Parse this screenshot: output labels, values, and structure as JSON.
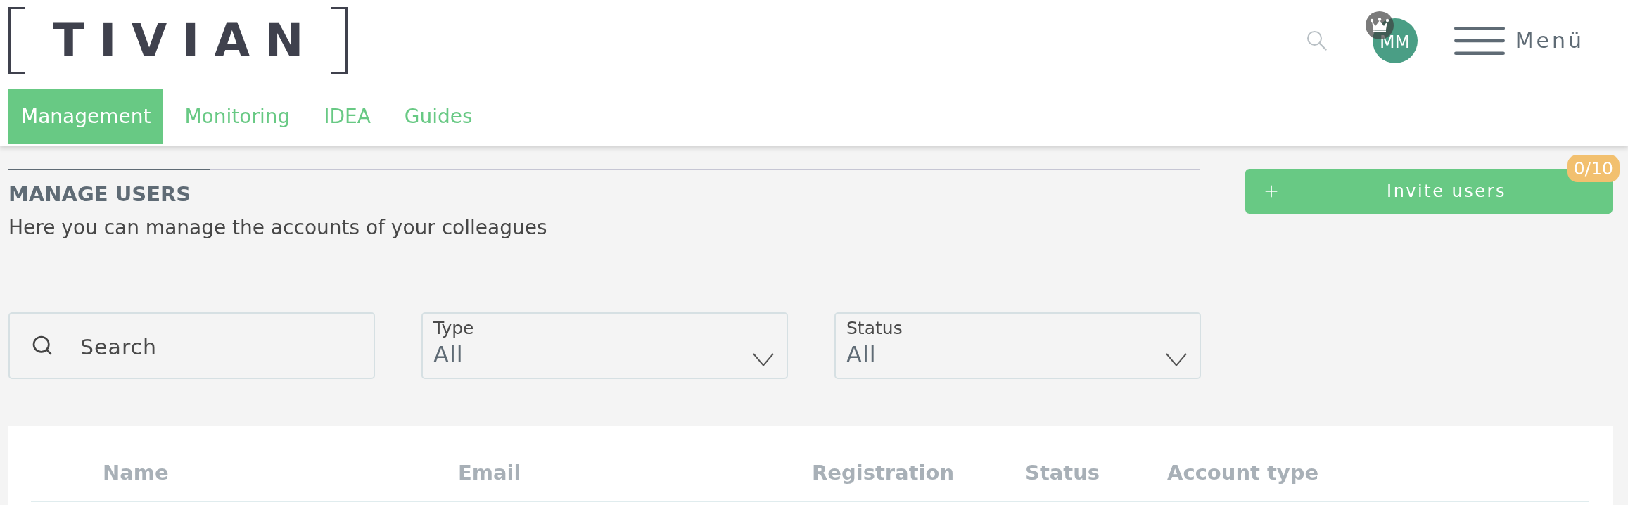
{
  "header": {
    "logo": "TIVIAN",
    "avatar_initials": "MM",
    "menu_label": "Menü"
  },
  "nav_tabs": [
    {
      "label": "Management",
      "selected": true
    },
    {
      "label": "Monitoring",
      "selected": false
    },
    {
      "label": "IDEA",
      "selected": false
    },
    {
      "label": "Guides",
      "selected": false
    }
  ],
  "page": {
    "title": "MANAGE USERS",
    "subtitle": "Here you can manage the accounts of your colleagues"
  },
  "invite_button": {
    "label": "Invite users",
    "badge": "0/10"
  },
  "filters": {
    "search": {
      "placeholder": "Search"
    },
    "dropdowns": [
      {
        "label": "Type",
        "value": "All"
      },
      {
        "label": "Status",
        "value": "All"
      }
    ]
  },
  "table": {
    "columns": [
      "Name",
      "Email",
      "Registration",
      "Status",
      "Account type"
    ]
  }
}
